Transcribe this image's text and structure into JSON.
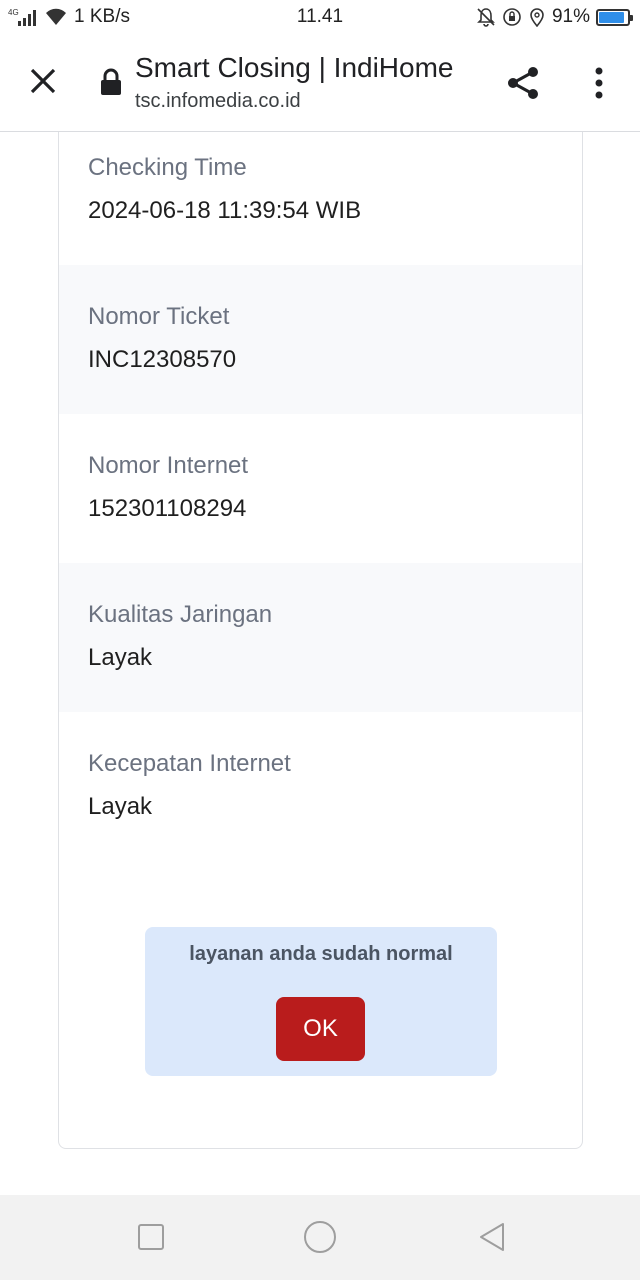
{
  "status_bar": {
    "network_type": "4G",
    "speed": "1 KB/s",
    "time": "11.41",
    "battery_percent": "91%",
    "battery_level": 0.91,
    "battery_color": "#2f8ee8",
    "icons": [
      "signal-icon",
      "wifi-icon",
      "mute-icon",
      "rotation-lock-icon",
      "location-icon",
      "battery-icon"
    ]
  },
  "toolbar": {
    "title": "Smart Closing | IndiHome",
    "url": "tsc.infomedia.co.id",
    "icons": [
      "close-icon",
      "lock-icon",
      "share-icon",
      "more-vert-icon"
    ]
  },
  "details": [
    {
      "label": "Checking Time",
      "value": "2024-06-18 11:39:54 WIB"
    },
    {
      "label": "Nomor Ticket",
      "value": "INC12308570"
    },
    {
      "label": "Nomor Internet",
      "value": "152301108294"
    },
    {
      "label": "Kualitas Jaringan",
      "value": "Layak"
    },
    {
      "label": "Kecepatan Internet",
      "value": "Layak"
    }
  ],
  "alert": {
    "message": "layanan anda sudah normal",
    "ok_label": "OK",
    "background_color": "#dbe8fb",
    "button_color": "#b91c1c"
  },
  "nav_bar": {
    "icons": [
      "recent-apps-icon",
      "home-icon",
      "back-icon"
    ]
  }
}
